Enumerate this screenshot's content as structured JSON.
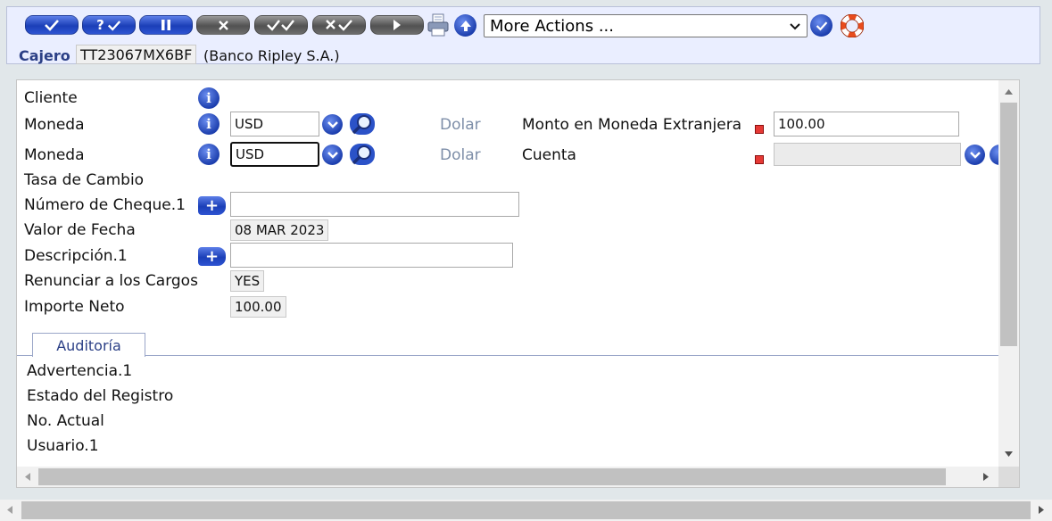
{
  "toolbar": {
    "buttons": [
      {
        "name": "commit-button",
        "label": "✓"
      },
      {
        "name": "validate-button",
        "label": "?✓"
      },
      {
        "name": "hold-button",
        "label": "II"
      },
      {
        "name": "delete-button",
        "label": "✕"
      },
      {
        "name": "authorise-button",
        "label": "✓✓"
      },
      {
        "name": "reverse-button",
        "label": "✕✓"
      },
      {
        "name": "next-button",
        "label": "▶"
      }
    ],
    "more_actions": "More Actions ...",
    "colors": {
      "blue": "#1b3fb8",
      "grey": "#525252",
      "panel": "#eaeeff"
    }
  },
  "header": {
    "cajero_label": "Cajero",
    "cajero_id": "TT23067MX6BF",
    "cajero_bank": "(Banco Ripley S.A.)"
  },
  "form": {
    "cliente_label": "Cliente",
    "moneda1_label": "Moneda",
    "moneda1_value": "USD",
    "moneda1_desc": "Dolar",
    "monto_label": "Monto en Moneda Extranjera",
    "monto_value": "100.00",
    "moneda2_label": "Moneda",
    "moneda2_value": "USD",
    "moneda2_desc": "Dolar",
    "cuenta_label": "Cuenta",
    "cuenta_value": "",
    "tasa_label": "Tasa de Cambio",
    "cheque_label": "Número de Cheque.1",
    "cheque_value": "",
    "fecha_label": "Valor de Fecha",
    "fecha_value": "08 MAR 2023",
    "descripcion_label": "Descripción.1",
    "descripcion_value": "",
    "renunciar_label": "Renunciar a los Cargos",
    "renunciar_value": "YES",
    "importe_label": "Importe Neto",
    "importe_value": "100.00"
  },
  "audit": {
    "tab_label": "Auditoría",
    "advertencia_label": "Advertencia.1",
    "estado_label": "Estado del Registro",
    "actual_label": "No. Actual",
    "usuario_label": "Usuario.1"
  }
}
